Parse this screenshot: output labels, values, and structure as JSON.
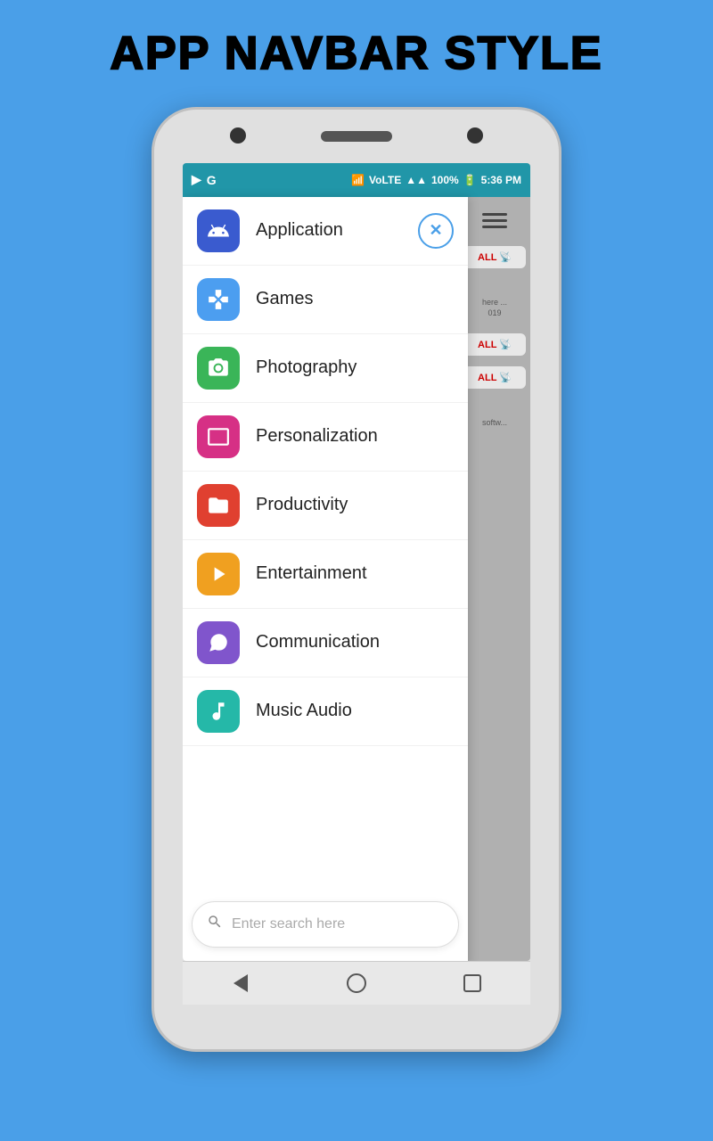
{
  "page": {
    "title": "APP NAVBAR STYLE",
    "background_color": "#4a9fe8"
  },
  "status_bar": {
    "time": "5:36 PM",
    "battery": "100%",
    "signal": "VoLTE",
    "icons_left": [
      "📹",
      "G"
    ]
  },
  "menu": {
    "items": [
      {
        "id": "application",
        "label": "Application",
        "icon_class": "icon-application",
        "icon_symbol": "🤖"
      },
      {
        "id": "games",
        "label": "Games",
        "icon_class": "icon-games",
        "icon_symbol": "🎮"
      },
      {
        "id": "photography",
        "label": "Photography",
        "icon_class": "icon-photography",
        "icon_symbol": "📷"
      },
      {
        "id": "personalization",
        "label": "Personalization",
        "icon_class": "icon-personalization",
        "icon_symbol": "🖥"
      },
      {
        "id": "productivity",
        "label": "Productivity",
        "icon_class": "icon-productivity",
        "icon_symbol": "📁"
      },
      {
        "id": "entertainment",
        "label": "Entertainment",
        "icon_class": "icon-entertainment",
        "icon_symbol": "▶"
      },
      {
        "id": "communication",
        "label": "Communication",
        "icon_class": "icon-communication",
        "icon_symbol": "↪"
      },
      {
        "id": "musicaudio",
        "label": "Music Audio",
        "icon_class": "icon-musicaudio",
        "icon_symbol": "🎵"
      }
    ],
    "close_button_label": "✕"
  },
  "search": {
    "placeholder": "Enter search here"
  },
  "background_labels": {
    "all_button": "ALL 📡",
    "all_button2": "ALL 📡",
    "softw": "softw..."
  }
}
